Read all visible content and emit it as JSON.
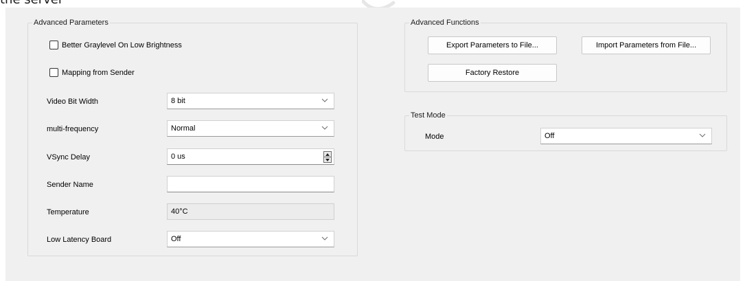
{
  "top_fragment": "the server",
  "advanced_parameters": {
    "title": "Advanced Parameters",
    "better_graylevel_label": "Better Graylevel On Low Brightness",
    "mapping_from_sender_label": "Mapping from Sender",
    "video_bit_width": {
      "label": "Video Bit Width",
      "value": "8 bit"
    },
    "multi_frequency": {
      "label": "multi-frequency",
      "value": "Normal"
    },
    "vsync_delay": {
      "label": "VSync Delay",
      "value": "0 us"
    },
    "sender_name": {
      "label": "Sender Name",
      "value": ""
    },
    "temperature": {
      "label": "Temperature",
      "value": "40°C"
    },
    "low_latency_board": {
      "label": "Low Latency Board",
      "value": "Off"
    }
  },
  "advanced_functions": {
    "title": "Advanced Functions",
    "export_label": "Export Parameters to File...",
    "import_label": "Import Parameters from File...",
    "factory_restore_label": "Factory Restore"
  },
  "test_mode": {
    "title": "Test Mode",
    "mode_label": "Mode",
    "mode_value": "Off"
  },
  "colors": {
    "panel_bg": "#f0f0f0",
    "group_border": "#d9d9d9",
    "input_bg": "#ffffff",
    "readonly_bg": "#ececec"
  }
}
